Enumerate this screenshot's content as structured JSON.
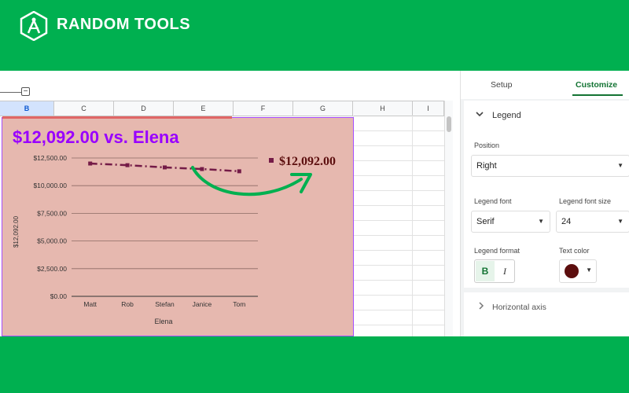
{
  "brand": {
    "name": "RANDOM TOOLS",
    "logo_icon": "compass-logo-icon"
  },
  "sheet": {
    "columns": [
      "B",
      "C",
      "D",
      "E",
      "F",
      "G",
      "H",
      "I"
    ],
    "active_column": "B"
  },
  "chart_data": {
    "type": "line",
    "title": "$12,092.00 vs. Elena",
    "xlabel": "Elena",
    "ylabel": "$12,092.00",
    "categories": [
      "Matt",
      "Rob",
      "Stefan",
      "Janice",
      "Tom"
    ],
    "series": [
      {
        "name": "$12,092.00",
        "values": [
          12000,
          11850,
          11650,
          11500,
          11300
        ],
        "color": "#741b47",
        "style": "dash-dot"
      }
    ],
    "ylim": [
      0,
      12500
    ],
    "yticks": [
      "$0.00",
      "$2,500.00",
      "$5,000.00",
      "$7,500.00",
      "$10,000.00",
      "$12,500.00"
    ],
    "ytick_values": [
      0,
      2500,
      5000,
      7500,
      10000,
      12500
    ],
    "legend_position": "right",
    "grid": true,
    "title_color": "#9900ff",
    "background": "#e6b8af",
    "arrow_color": "#00b050"
  },
  "panel": {
    "tabs": {
      "setup": "Setup",
      "customize": "Customize"
    },
    "legend_section": "Legend",
    "position_label": "Position",
    "position_value": "Right",
    "legend_font_label": "Legend font",
    "legend_font_value": "Serif",
    "legend_font_size_label": "Legend font size",
    "legend_font_size_value": "24",
    "legend_format_label": "Legend format",
    "bold_label": "B",
    "italic_label": "I",
    "text_color_label": "Text color",
    "text_color_value": "#5c0e0e",
    "horizontal_axis_section": "Horizontal axis"
  }
}
